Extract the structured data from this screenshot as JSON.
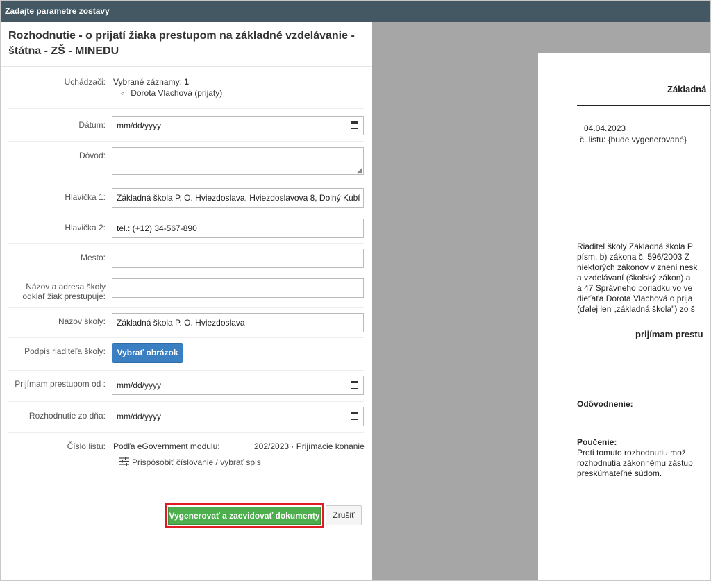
{
  "window": {
    "title": "Zadajte parametre zostavy"
  },
  "form": {
    "heading": "Rozhodnutie - o prijatí žiaka prestupom na základné vzdelávanie - štátna - ZŠ - MINEDU",
    "applicants": {
      "label": "Uchádzači:",
      "selected_text": "Vybrané záznamy:",
      "selected_count": "1",
      "items": [
        "Dorota Vlachová (prijaty)"
      ]
    },
    "date": {
      "label": "Dátum:",
      "placeholder": "mm/dd/yyyy"
    },
    "reason": {
      "label": "Dôvod:",
      "value": ""
    },
    "header1": {
      "label": "Hlavička 1:",
      "value": "Základná škola P. O. Hviezdoslava, Hviezdoslavova 8, Dolný Kubí"
    },
    "header2": {
      "label": "Hlavička 2:",
      "value": "tel.: (+12) 34-567-890"
    },
    "city": {
      "label": "Mesto:",
      "value": ""
    },
    "school_from": {
      "label_line1": "Názov a adresa školy",
      "label_line2": "odkiaľ žiak prestupuje:",
      "value": ""
    },
    "school_name": {
      "label": "Názov školy:",
      "value": "Základná škola P. O. Hviezdoslava"
    },
    "signature": {
      "label": "Podpis riaditeľa školy:",
      "button": "Vybrať obrázok"
    },
    "accept_from": {
      "label": "Prijímam prestupom od :",
      "placeholder": "mm/dd/yyyy"
    },
    "decision_date": {
      "label": "Rozhodnutie zo dňa:",
      "placeholder": "mm/dd/yyyy"
    },
    "sheet_number": {
      "label": "Číslo listu:",
      "source": "Podľa eGovernment modulu:",
      "value": "202/2023 · Prijímacie konanie",
      "customize_link": "Prispôsobiť číslovanie / vybrať spis"
    },
    "buttons": {
      "generate": "Vygenerovať a zaevidovať dokumenty",
      "cancel": "Zrušiť"
    }
  },
  "preview": {
    "title_fragment": "Základná",
    "date": "04.04.2023",
    "sheet_no": "č. listu: {bude vygenerované}",
    "paragraph_lines": [
      "Riaditeľ školy Základná škola P",
      "písm. b) zákona č. 596/2003 Z",
      "niektorých zákonov v znení nesk",
      "a vzdelávaní (školský zákon) a",
      "a 47 Správneho poriadku vo ve",
      "dieťaťa Dorota Vlachová o prija",
      "(ďalej len „základná škola\") zo š"
    ],
    "decision_fragment": "prijímam prestu",
    "reasoning_heading": "Odôvodnenie:",
    "instruction_heading": "Poučenie:",
    "instruction_lines": [
      "Proti tomuto rozhodnutiu mož",
      "rozhodnutia zákonnému zástup",
      "preskúmateľné súdom."
    ]
  }
}
